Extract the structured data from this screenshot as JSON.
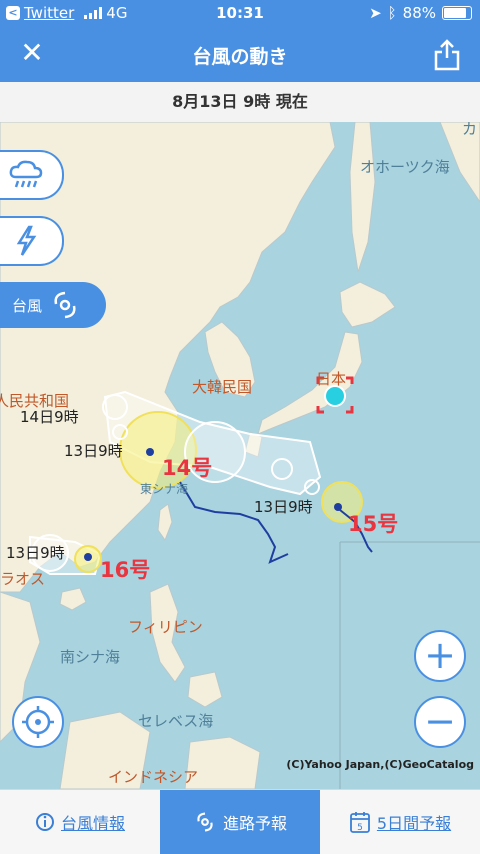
{
  "status": {
    "carrier": "Twitter",
    "network": "4G",
    "time": "10:31",
    "battery": "88%",
    "back_chip": "<"
  },
  "nav": {
    "title": "台風の動き",
    "close": "✕"
  },
  "datebar": {
    "text": "8月13日 9時 現在"
  },
  "side": {
    "typhoon_label": "台風"
  },
  "map": {
    "labels": {
      "okhotsk": "オホーツク海",
      "korea": "大韓民国",
      "japan": "日本",
      "china": "人民共和国",
      "laos": "ラオス",
      "philippines": "フィリピン",
      "south_china_sea": "南シナ海",
      "celebes": "セレベス海",
      "indonesia": "インドネシア",
      "east_china_sea": "東シナ海",
      "edge_ka": "カ"
    },
    "typhoons": [
      {
        "name": "14号",
        "time": "13日9時",
        "prev_time": "14日9時"
      },
      {
        "name": "15号",
        "time": "13日9時"
      },
      {
        "name": "16号",
        "time": "13日9時"
      }
    ],
    "copyright": "(C)Yahoo Japan,(C)GeoCatalog",
    "zoom_in": "+",
    "zoom_out": "−"
  },
  "tabs": [
    {
      "label": "台風情報"
    },
    {
      "label": "進路予報"
    },
    {
      "label": "5日間予報",
      "calendar_day": "5"
    }
  ],
  "colors": {
    "accent": "#4a90e2",
    "sea": "#a9d3df",
    "land": "#f3efdc",
    "typhoon_red": "#e8353f",
    "track_blue": "#1f3fa0"
  }
}
